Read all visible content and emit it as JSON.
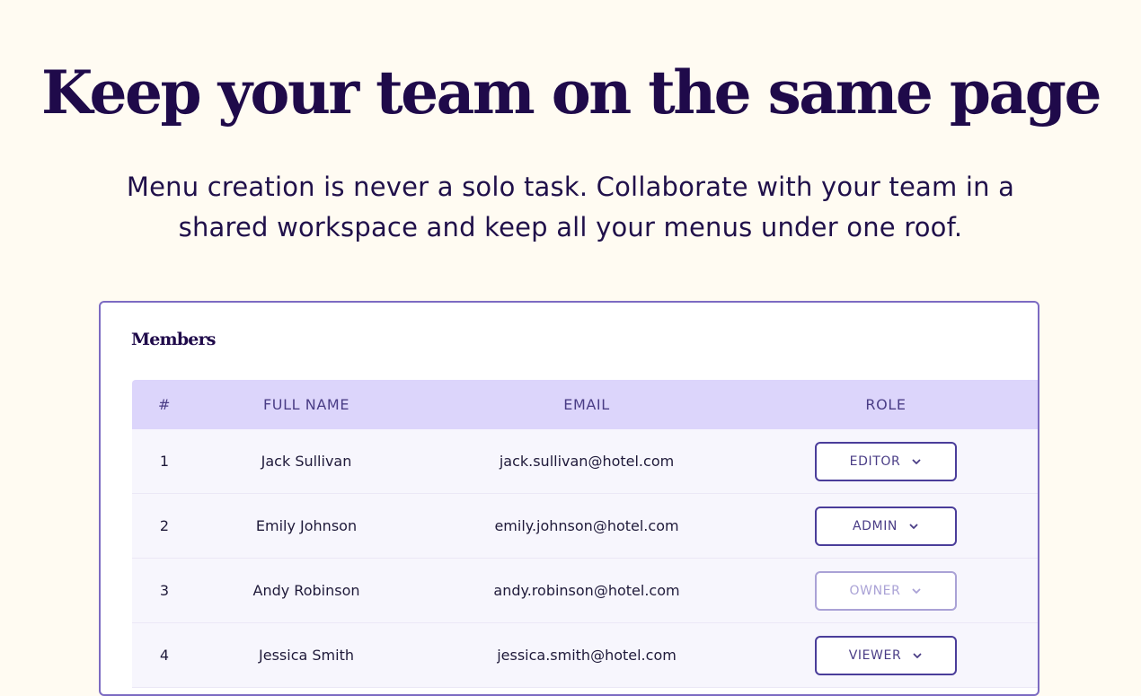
{
  "hero": {
    "title": "Keep your team on the same page",
    "subtitle": "Menu creation is never a solo task. Collaborate with your team in a shared workspace and keep all your menus under one roof."
  },
  "members": {
    "title": "Members",
    "columns": {
      "number": "#",
      "full_name": "FULL NAME",
      "email": "EMAIL",
      "role": "ROLE"
    },
    "rows": [
      {
        "number": "1",
        "name": "Jack Sullivan",
        "email": "jack.sullivan@hotel.com",
        "role": "EDITOR",
        "role_disabled": false
      },
      {
        "number": "2",
        "name": "Emily Johnson",
        "email": "emily.johnson@hotel.com",
        "role": "ADMIN",
        "role_disabled": false
      },
      {
        "number": "3",
        "name": "Andy Robinson",
        "email": "andy.robinson@hotel.com",
        "role": "OWNER",
        "role_disabled": true
      },
      {
        "number": "4",
        "name": "Jessica Smith",
        "email": "jessica.smith@hotel.com",
        "role": "VIEWER",
        "role_disabled": false
      }
    ]
  },
  "icons": {
    "role_dropdown": "chevron-down-icon"
  },
  "colors": {
    "background": "#fffbf2",
    "heading": "#1f0a4a",
    "card_border": "#7c6bc2",
    "table_header": "#dcd5fb",
    "row_background": "#f7f6fd",
    "select_border": "#4a3d9a",
    "select_disabled": "#aaa2d6"
  }
}
